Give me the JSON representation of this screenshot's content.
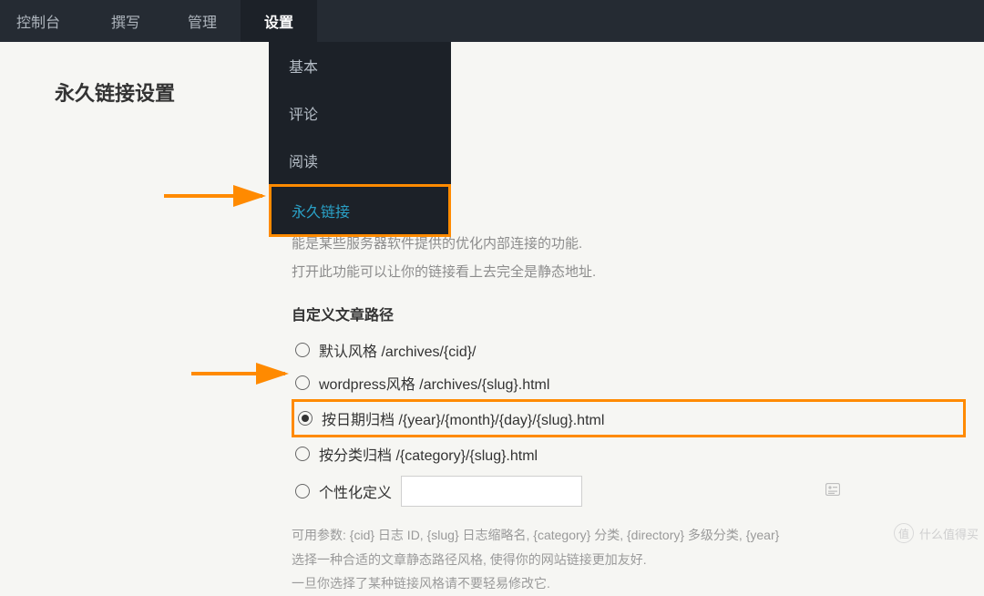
{
  "nav": {
    "items": [
      {
        "label": "控制台"
      },
      {
        "label": "撰写"
      },
      {
        "label": "管理"
      },
      {
        "label": "设置"
      }
    ],
    "active_index": 3
  },
  "submenu": {
    "items": [
      {
        "label": "基本"
      },
      {
        "label": "评论"
      },
      {
        "label": "阅读"
      },
      {
        "label": "永久链接"
      }
    ],
    "selected_index": 3
  },
  "page": {
    "title": "永久链接设置"
  },
  "sections": {
    "rewrite": {
      "heading_fragment": "能",
      "desc1_fragment": "能是某些服务器软件提供的优化内部连接的功能.",
      "desc2": "打开此功能可以让你的链接看上去完全是静态地址."
    },
    "custom_path": {
      "heading": "自定义文章路径",
      "options": [
        {
          "label": "默认风格 /archives/{cid}/",
          "checked": false
        },
        {
          "label": "wordpress风格 /archives/{slug}.html",
          "checked": false
        },
        {
          "label": "按日期归档 /{year}/{month}/{day}/{slug}.html",
          "checked": true
        },
        {
          "label": "按分类归档 /{category}/{slug}.html",
          "checked": false
        },
        {
          "label": "个性化定义",
          "checked": false
        }
      ],
      "custom_value": ""
    },
    "help": {
      "line1": "可用参数: {cid} 日志 ID, {slug} 日志缩略名, {category} 分类, {directory} 多级分类, {year}",
      "line2": "选择一种合适的文章静态路径风格, 使得你的网站链接更加友好.",
      "line3": "一旦你选择了某种链接风格请不要轻易修改它."
    }
  },
  "watermark": {
    "logo": "值",
    "text": "什么值得买"
  },
  "colors": {
    "highlight": "#ff8a00",
    "nav_bg": "#252b33",
    "submenu_bg": "#1c2128",
    "link_active": "#2aa1c7"
  }
}
